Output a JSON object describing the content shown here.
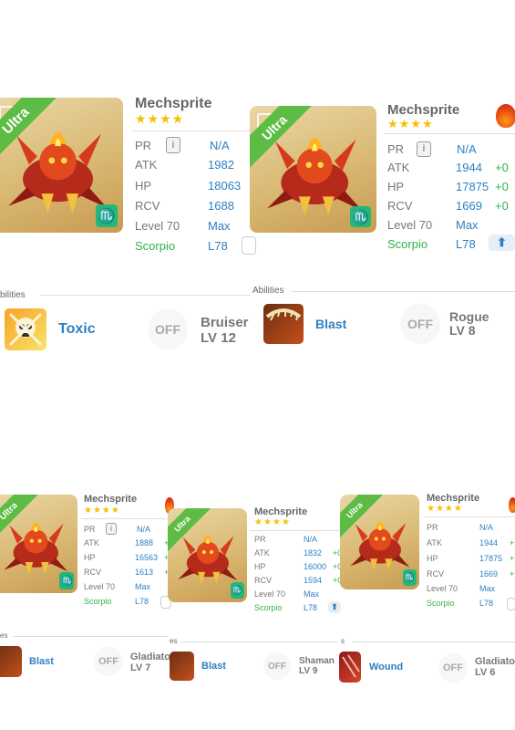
{
  "colors": {
    "accent": "#2f7fc1",
    "ultra": "#5cbc43",
    "scorpio": "#25b678",
    "star": "#f4c000",
    "fire": "#e84a12"
  },
  "icons": {
    "info": "info-icon",
    "upgrade": "arrow-up-icon",
    "element": "fire-icon",
    "off": "off-badge-icon"
  },
  "top_left": {
    "name": "Mechsprite",
    "stars": "★★★★",
    "rarity": "Ultra",
    "emblem": "♏",
    "pr": {
      "label": "PR",
      "value": "N/A"
    },
    "atk": {
      "label": "ATK",
      "value": "1982"
    },
    "hp": {
      "label": "HP",
      "value": "18063"
    },
    "rcv": {
      "label": "RCV",
      "value": "1688"
    },
    "level": {
      "label": "Level 70",
      "value": "Max"
    },
    "scorpio": {
      "label": "Scorpio",
      "value": "L78"
    },
    "abilities": {
      "heading": "bilities",
      "name": "Toxic",
      "off": "OFF",
      "other_name": "Bruiser",
      "other_lv": "LV 12"
    }
  },
  "top_right": {
    "name": "Mechsprite",
    "stars": "★★★★",
    "rarity": "Ultra",
    "emblem": "♏",
    "pr": {
      "label": "PR",
      "value": "N/A"
    },
    "atk": {
      "label": "ATK",
      "value": "1944",
      "delta": "+0"
    },
    "hp": {
      "label": "HP",
      "value": "17875",
      "delta": "+0"
    },
    "rcv": {
      "label": "RCV",
      "value": "1669",
      "delta": "+0"
    },
    "level": {
      "label": "Level 70",
      "value": "Max"
    },
    "scorpio": {
      "label": "Scorpio",
      "value": "L78"
    },
    "abilities": {
      "heading": "Abilities",
      "name": "Blast",
      "off": "OFF",
      "other_name": "Rogue",
      "other_lv": "LV 8"
    }
  },
  "bottom_1": {
    "name": "Mechsprite",
    "stars": "★★★★",
    "rarity": "Ultra",
    "emblem": "♏",
    "pr": {
      "label": "PR",
      "value": "N/A"
    },
    "atk": {
      "label": "ATK",
      "value": "1888",
      "delta": "+"
    },
    "hp": {
      "label": "HP",
      "value": "16563",
      "delta": "+"
    },
    "rcv": {
      "label": "RCV",
      "value": "1613",
      "delta": "+"
    },
    "level": {
      "label": "Level 70",
      "value": "Max"
    },
    "scorpio": {
      "label": "Scorpio",
      "value": "L78"
    },
    "abilities": {
      "heading": "es",
      "name": "Blast",
      "off": "OFF",
      "other_name": "Gladiato",
      "other_lv": "LV 7"
    }
  },
  "bottom_2": {
    "name": "Mechsprite",
    "stars": "★★★★",
    "rarity": "Ultra",
    "emblem": "♏",
    "pr": {
      "label": "PR",
      "value": "N/A"
    },
    "atk": {
      "label": "ATK",
      "value": "1832",
      "delta": "+0"
    },
    "hp": {
      "label": "HP",
      "value": "16000",
      "delta": "+0"
    },
    "rcv": {
      "label": "RCV",
      "value": "1594",
      "delta": "+0"
    },
    "level": {
      "label": "Level 70",
      "value": "Max"
    },
    "scorpio": {
      "label": "Scorpio",
      "value": "L78"
    },
    "abilities": {
      "heading": "es",
      "name": "Blast",
      "off": "OFF",
      "other_name": "Shaman",
      "other_lv": "LV 9"
    }
  },
  "bottom_3": {
    "name": "Mechsprite",
    "stars": "★★★★",
    "rarity": "Ultra",
    "emblem": "♏",
    "pr": {
      "label": "PR",
      "value": "N/A"
    },
    "atk": {
      "label": "ATK",
      "value": "1944",
      "delta": "+"
    },
    "hp": {
      "label": "HP",
      "value": "17875",
      "delta": "+"
    },
    "rcv": {
      "label": "RCV",
      "value": "1669",
      "delta": "+"
    },
    "level": {
      "label": "Level 70",
      "value": "Max"
    },
    "scorpio": {
      "label": "Scorpio",
      "value": "L78"
    },
    "abilities": {
      "heading": "s",
      "name": "Wound",
      "off": "OFF",
      "other_name": "Gladiato",
      "other_lv": "LV 6"
    }
  }
}
